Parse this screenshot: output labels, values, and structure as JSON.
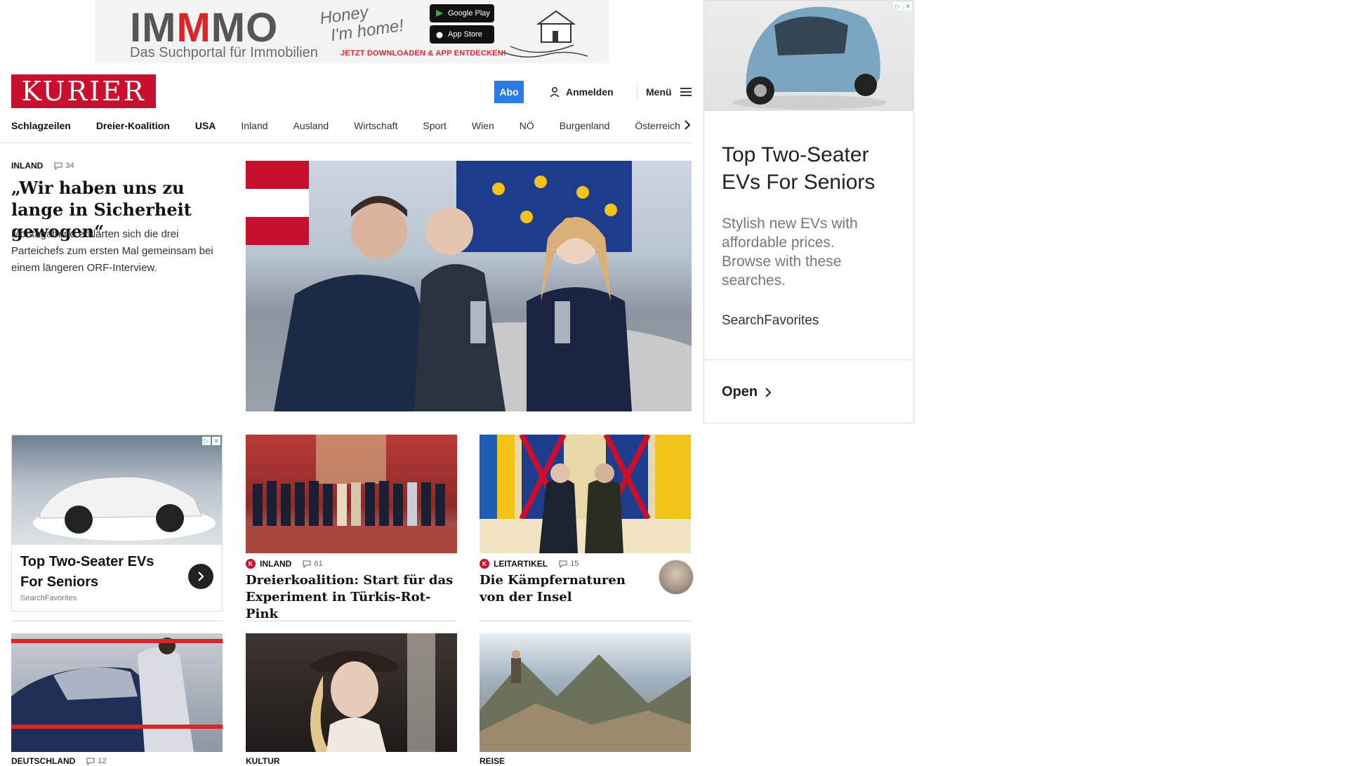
{
  "banner": {
    "brand_pre": "IM",
    "brand_mid": "M",
    "brand_post": "MO",
    "subtitle": "Das Suchportal für Immobilien",
    "honey_line1": "Honey",
    "honey_line2": "I'm home!",
    "google_play": "Google Play",
    "app_store": "App Store",
    "cta": "JETZT DOWNLOADEN & APP ENTDECKEN!"
  },
  "header": {
    "logo": "KURIER",
    "abo": "Abo",
    "login": "Anmelden",
    "menu": "Menü"
  },
  "nav": {
    "items": [
      "Schlagzeilen",
      "Dreier-Koalition",
      "USA",
      "Inland",
      "Ausland",
      "Wirtschaft",
      "Sport",
      "Wien",
      "NÖ",
      "Burgenland",
      "Österreich"
    ]
  },
  "lead": {
    "category": "INLAND",
    "comments": "34",
    "title": "„Wir haben uns zu lange in Sicherheit gewogen“",
    "description": "Montagabend erklärten sich die drei Parteichefs zum ersten Mal gemeinsam bei einem längeren ORF-Interview."
  },
  "ad_card": {
    "title": "Top Two-Seater EVs For Seniors",
    "source": "SearchFavorites"
  },
  "cards": [
    {
      "category": "INLAND",
      "comments": "61",
      "title": "Dreierkoalition: Start für das Experiment in Türkis-Rot-Pink"
    },
    {
      "category": "LEITARTIKEL",
      "comments": "15",
      "title": "Die Kämpfernaturen von der Insel"
    }
  ],
  "bottom_cards": [
    {
      "category": "DEUTSCHLAND",
      "comments": "12"
    },
    {
      "category": "KULTUR"
    },
    {
      "category": "REISE"
    }
  ],
  "side_ad": {
    "title": "Top Two-Seater EVs For Seniors",
    "description": "Stylish new EVs with affordable prices. Browse with these searches.",
    "source": "SearchFavorites",
    "open": "Open"
  }
}
